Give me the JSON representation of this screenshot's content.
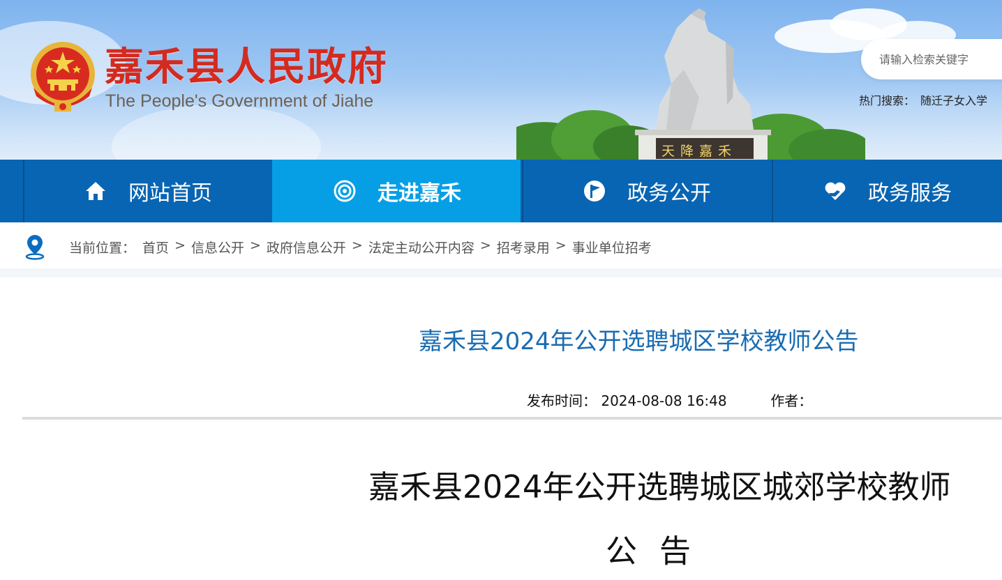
{
  "header": {
    "title": "嘉禾县人民政府",
    "subtitle": "The People's Government of Jiahe",
    "emblem_icon": "national-emblem-icon",
    "statue_inscription": "天降嘉禾",
    "search": {
      "placeholder": "请输入检索关键字"
    },
    "hot_search": {
      "label": "热门搜索：",
      "items": [
        "随迁子女入学"
      ]
    }
  },
  "nav": {
    "items": [
      {
        "label": "网站首页",
        "icon": "home-icon",
        "active": false
      },
      {
        "label": "走进嘉禾",
        "icon": "target-icon",
        "active": true
      },
      {
        "label": "政务公开",
        "icon": "flag-icon",
        "active": false
      },
      {
        "label": "政务服务",
        "icon": "heart-hand-icon",
        "active": false
      }
    ],
    "colors": {
      "bar": "#0865b3",
      "active": "#069fe6"
    }
  },
  "breadcrumb": {
    "lead": "当前位置：",
    "items": [
      "首页",
      "信息公开",
      "政府信息公开",
      "法定主动公开内容",
      "招考录用",
      "事业单位招考"
    ],
    "separator": ">"
  },
  "article": {
    "title": "嘉禾县2024年公开选聘城区学校教师公告",
    "publish_label": "发布时间：",
    "publish_time": "2024-08-08 16:48",
    "author_label": "作者：",
    "body_heading": "嘉禾县2024年公开选聘城区城郊学校教师",
    "body_subheading": "公告",
    "title_color": "#1a6cb2"
  }
}
